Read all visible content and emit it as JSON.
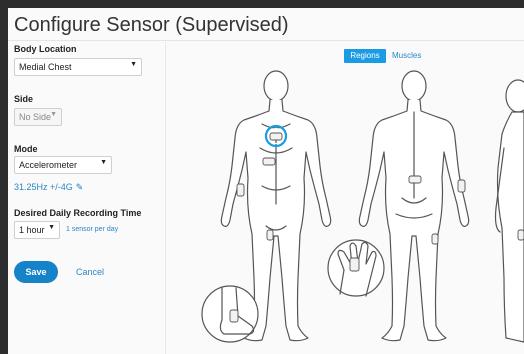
{
  "title": "Configure Sensor (Supervised)",
  "body_location": {
    "label": "Body Location",
    "value": "Medial Chest"
  },
  "side": {
    "label": "Side",
    "value": "No Side"
  },
  "mode": {
    "label": "Mode",
    "value": "Accelerometer",
    "info": "31.25Hz +/-4G"
  },
  "recording": {
    "label": "Desired Daily Recording Time",
    "value": "1 hour",
    "note": "1 sensor per day"
  },
  "buttons": {
    "save": "Save",
    "cancel": "Cancel"
  },
  "tabs": {
    "regions": "Regions",
    "muscles": "Muscles",
    "active": "Regions"
  },
  "colors": {
    "accent": "#1683c9",
    "tab_active": "#1a9be4",
    "link": "#2a86c6",
    "highlight_ring": "#1a9be4"
  },
  "icons": [
    "chevron-down-icon",
    "pencil-icon",
    "sensor-icon",
    "body-front-icon",
    "body-back-icon",
    "body-side-icon",
    "hand-icon",
    "foot-icon"
  ]
}
